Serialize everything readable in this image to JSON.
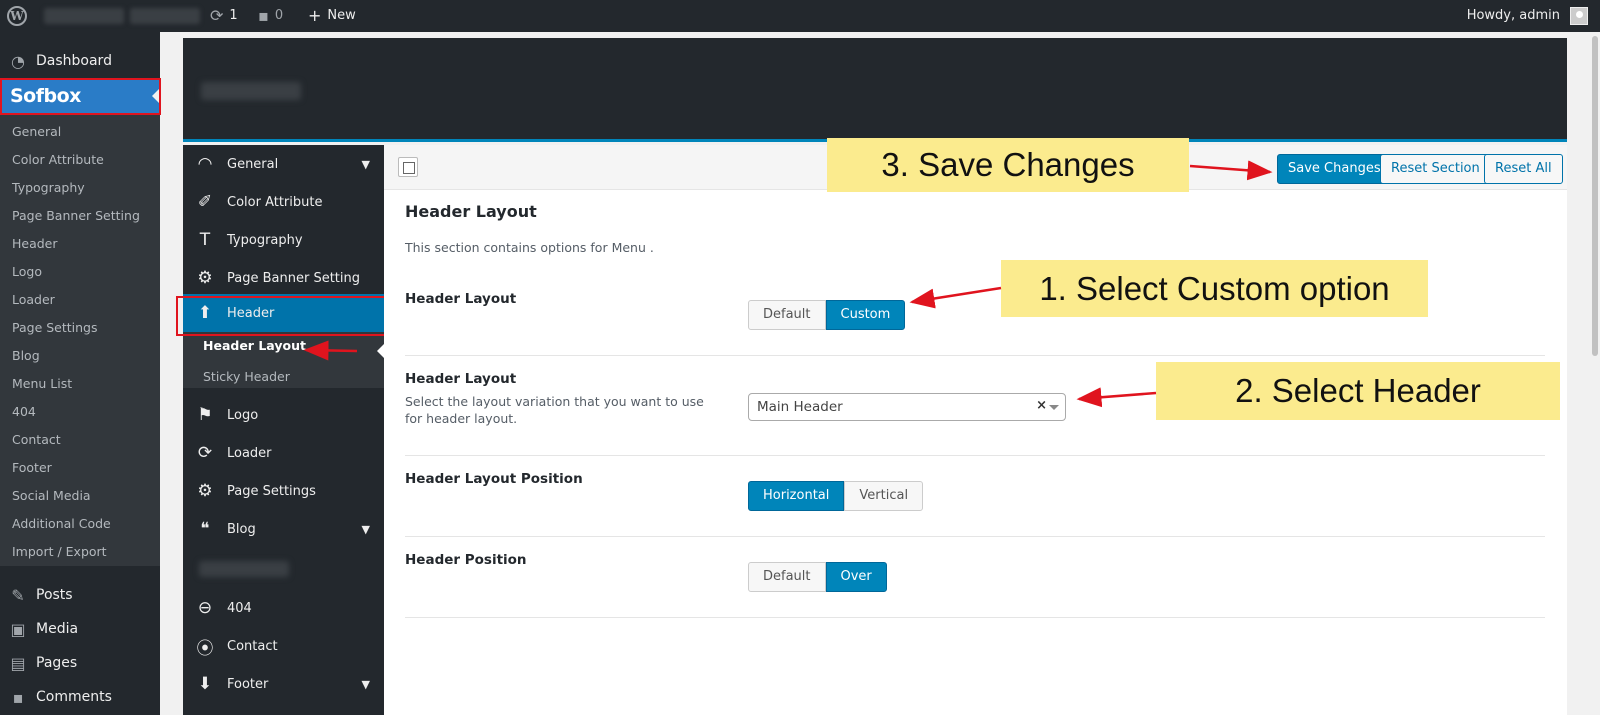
{
  "adminbar": {
    "updates_count": "1",
    "comments_count": "0",
    "new_label": "New",
    "howdy": "Howdy, admin"
  },
  "adminmenu": {
    "dashboard": "Dashboard",
    "sofbox": "Sofbox",
    "sofbox_submenu": [
      "General",
      "Color Attribute",
      "Typography",
      "Page Banner Setting",
      "Header",
      "Logo",
      "Loader",
      "Page Settings",
      "Blog",
      "Menu List",
      "404",
      "Contact",
      "Footer",
      "Social Media",
      "Additional Code",
      "Import / Export"
    ],
    "posts": "Posts",
    "media": "Media",
    "pages": "Pages",
    "comments": "Comments"
  },
  "redux_sidebar": {
    "items": [
      "General",
      "Color Attribute",
      "Typography",
      "Page Banner Setting",
      "Header"
    ],
    "header_sub": [
      "Header Layout",
      "Sticky Header"
    ],
    "items_after": [
      "Logo",
      "Loader",
      "Page Settings",
      "Blog"
    ],
    "items_bottom": [
      "404",
      "Contact",
      "Footer"
    ]
  },
  "toolbar": {
    "save": "Save Changes",
    "reset_section": "Reset Section",
    "reset_all": "Reset All"
  },
  "section": {
    "title": "Header Layout",
    "desc": "This section contains options for Menu ."
  },
  "fields": {
    "layout_toggle": {
      "label": "Header Layout",
      "options": [
        "Default",
        "Custom"
      ],
      "selected": "Custom"
    },
    "layout_select": {
      "label": "Header Layout",
      "desc": "Select the layout variation that you want to use for header layout.",
      "value": "Main Header"
    },
    "layout_position": {
      "label": "Header Layout Position",
      "options": [
        "Horizontal",
        "Vertical"
      ],
      "selected": "Horizontal"
    },
    "header_position": {
      "label": "Header Position",
      "options": [
        "Default",
        "Over"
      ],
      "selected": "Over"
    }
  },
  "annotations": {
    "step1": "1. Select Custom option",
    "step2": "2. Select Header",
    "step3": "3. Save Changes"
  },
  "colors": {
    "accent": "#0085ba",
    "admin_dark": "#23282d",
    "note_yellow": "#fbeb8e",
    "highlight_red": "#e0141e"
  }
}
